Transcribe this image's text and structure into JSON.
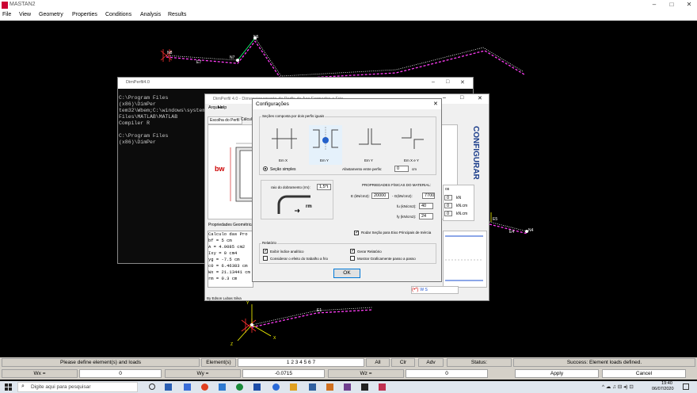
{
  "app": {
    "title": "MASTAN2",
    "menu": [
      "File",
      "View",
      "Geometry",
      "Properties",
      "Conditions",
      "Analysis",
      "Results"
    ],
    "window_controls": [
      "–",
      "□",
      "✕"
    ]
  },
  "canvas": {
    "labels": {
      "n8": "N8",
      "n6": "N6",
      "n4": "N4",
      "n7": "N7",
      "e7": "E7",
      "e4": "E4",
      "e5": "E5",
      "e1": "E1",
      "e_mid": "E",
      "axis_x": "X",
      "axis_y": "Y",
      "axis_z": "Z"
    }
  },
  "cmd_window": {
    "title": "DimPerfil4.0",
    "lines": [
      "C:\\Program Files (x86)\\DimPer",
      "tem32\\Wbem;C:\\windows\\system32",
      "Files\\MATLAB\\MATLAB Compiler R",
      "",
      "C:\\Program Files (x86)\\DimPer"
    ]
  },
  "dimperfil": {
    "title": "DimPerfil 4.0 - Dimensionamento de Perfis de Aço Formados a Frio",
    "menu": [
      "Arquivo",
      "Help"
    ],
    "tabs": [
      "Escolha do Perfil",
      "Cálculo"
    ],
    "bw_label": "bw",
    "side_label": "CONFIGURAR",
    "props_header": "Propriedades Geométricas",
    "props_lines": [
      "Calculo das Pro",
      "bf = 5 cm",
      "A = 4.0085 cm2",
      "Ixy = 0 cm4",
      "yg = -7.5 cm",
      "c0 = 6.46383 cm",
      "Wx = 21.13441 cm",
      "rm = 0.3 cm"
    ],
    "author": "By Edson Lubas Silva",
    "right_units": [
      "kN",
      "kN.cm",
      "kN.cm"
    ],
    "right_values": [
      "0",
      "0",
      "0"
    ],
    "right_header": "os",
    "bottom_code": "W S"
  },
  "config": {
    "title": "Configurações",
    "close": "✕",
    "section_group_title": "Seções composta por dois perfis iguais",
    "options": [
      "Em X",
      "Em Y",
      "Em Y",
      "Em X e Y"
    ],
    "simple_section": "Seção simples",
    "spacing_label": "Afastamento entre perfis:",
    "spacing_value": "0",
    "spacing_unit": "cm",
    "bend_label": "raio do dobramento (rm):",
    "bend_value": "1,5*t",
    "rm_label": "rm",
    "material_title": "PROPRIEDADES FÍSICAS DO MATERIAL:",
    "e_label": "E (kN/cm2):",
    "e_value": "20000",
    "g_label": "- G(kN/cm2):",
    "g_value": "7700",
    "fu_label": "fu (kN/cm2):",
    "fu_value": "40",
    "fy_label": "fy (kN/cm2):",
    "fy_value": "24",
    "rotate_label": "Rodar Seção para Eixo Principais de Inércia",
    "rotate_checked": true,
    "report_title": "Relatório",
    "report_items": [
      {
        "label": "Exibir índice analítico",
        "checked": true
      },
      {
        "label": "Gerar Relatório",
        "checked": true
      },
      {
        "label": "Considerar o efeito do trabalho a frio",
        "checked": false
      },
      {
        "label": "Mostrar Graficamente passo a passo",
        "checked": false
      }
    ],
    "ok": "OK"
  },
  "status": {
    "left_message": "Please define element(s) and loads",
    "elements_label": "Element(s)",
    "elements_value": "1 2 3 4 5 6 7",
    "all_btn": "All",
    "clr_btn": "Clr",
    "adv_btn": "Adv",
    "status_label": "Status:",
    "status_message": "Success: Element loads defined."
  },
  "inputs": {
    "wx_label": "Wx =",
    "wx_value": "0",
    "wy_label": "Wy =",
    "wy_value": "-0.0715",
    "wz_label": "Wz =",
    "wz_value": "0",
    "apply": "Apply",
    "cancel": "Cancel"
  },
  "taskbar": {
    "search_placeholder": "Digite aqui para pesquisar",
    "time": "19:40",
    "date": "06/07/2020",
    "tray": "^ ☁ ♫ ⊟ ◂) ⊡"
  },
  "colors": {
    "structure": "#ff3df5",
    "frame_lines": "#ffffff",
    "axis": "#ffff00",
    "support": "#ff3030",
    "status_bg": "#d4d0c8",
    "accent": "#0078d7"
  }
}
